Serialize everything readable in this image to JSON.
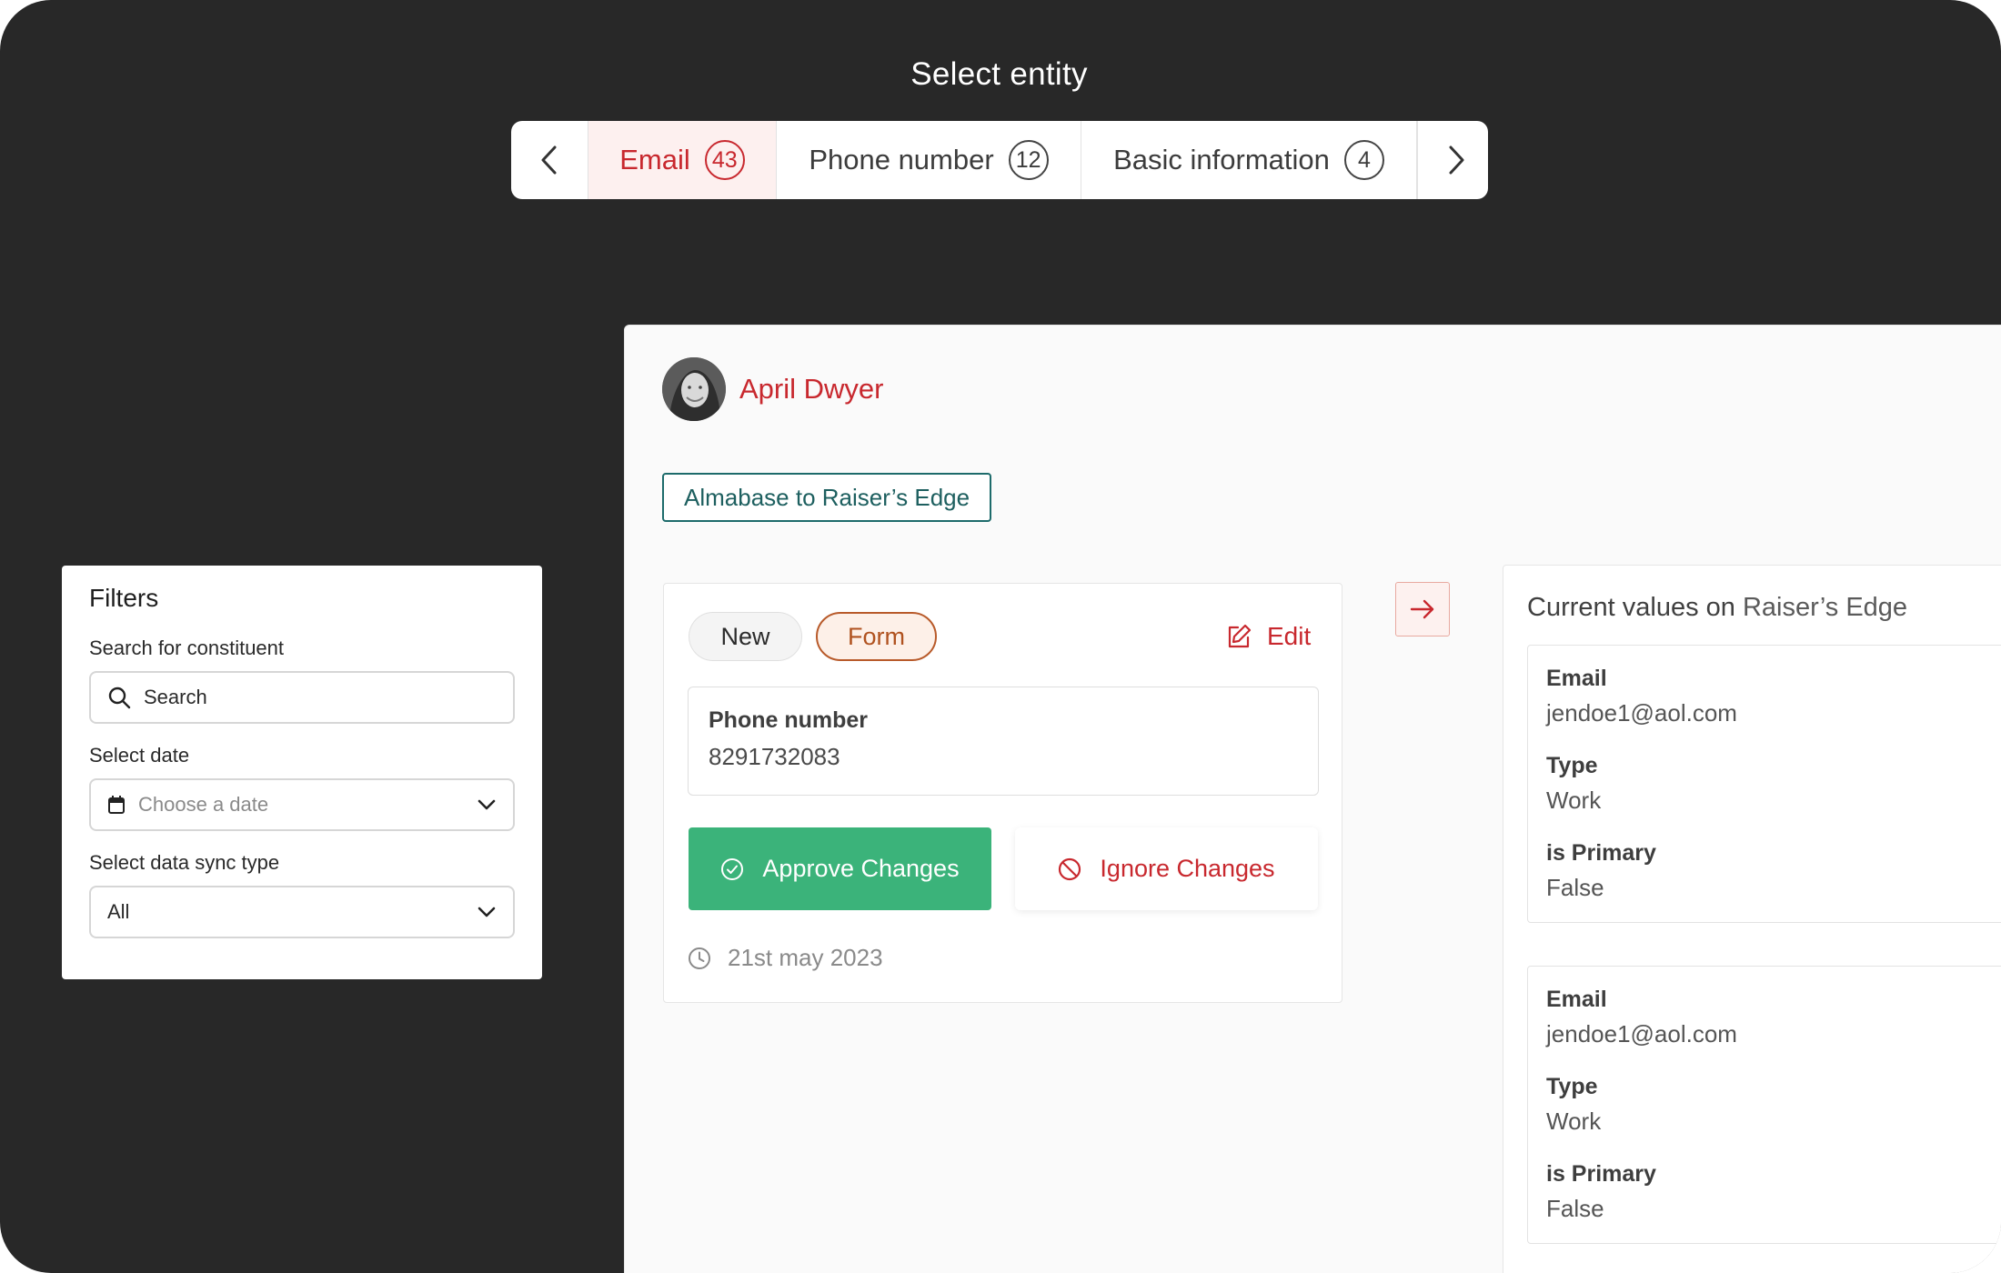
{
  "header": {
    "title": "Select entity"
  },
  "tabs": [
    {
      "label": "Email",
      "count": "43",
      "active": true
    },
    {
      "label": "Phone number",
      "count": "12",
      "active": false
    },
    {
      "label": "Basic information",
      "count": "4",
      "active": false
    }
  ],
  "filters": {
    "title": "Filters",
    "constituent_label": "Search for constituent",
    "search_placeholder": "Search",
    "date_label": "Select date",
    "date_placeholder": "Choose a date",
    "sync_label": "Select data sync type",
    "sync_value": "All"
  },
  "record": {
    "name": "April Dwyer",
    "sync_direction": "Almabase to Raiser’s Edge",
    "tags": {
      "new": "New",
      "form": "Form"
    },
    "edit_label": "Edit",
    "field_label": "Phone number",
    "field_value": "8291732083",
    "approve_label": "Approve Changes",
    "ignore_label": "Ignore Changes",
    "date": "21st may 2023"
  },
  "current_values": {
    "title_prefix": "Current values on",
    "title_target": "Raiser’s Edge",
    "records": [
      {
        "email_label": "Email",
        "email": "jendoe1@aol.com",
        "type_label": "Type",
        "type": "Work",
        "primary_label": "is Primary",
        "primary": "False"
      },
      {
        "email_label": "Email",
        "email": "jendoe1@aol.com",
        "type_label": "Type",
        "type": "Work",
        "primary_label": "is Primary",
        "primary": "False"
      }
    ]
  },
  "colors": {
    "accent": "#c8282e",
    "approve": "#3bb37a",
    "teal": "#1d6b6b",
    "background": "#282828"
  }
}
